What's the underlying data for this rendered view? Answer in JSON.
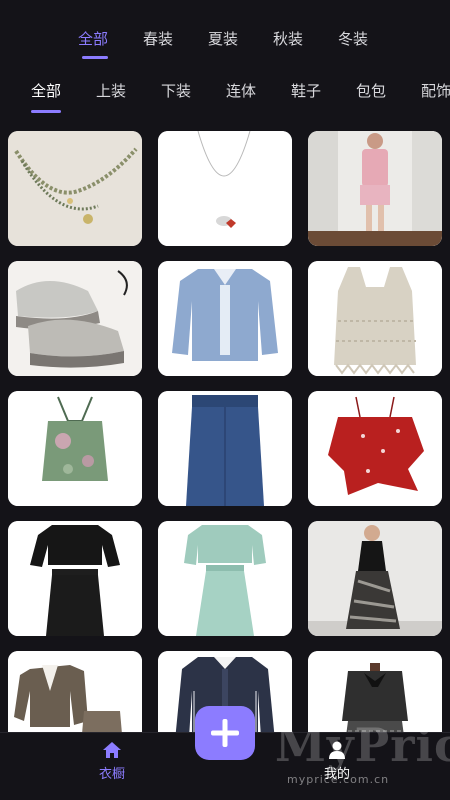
{
  "season_tabs": [
    "全部",
    "春装",
    "夏装",
    "秋装",
    "冬装"
  ],
  "season_active": "全部",
  "category_tabs": [
    "全部",
    "上装",
    "下装",
    "连体",
    "鞋子",
    "包包",
    "配饰"
  ],
  "category_active": "全部",
  "items": [
    {
      "name": "beaded-necklace"
    },
    {
      "name": "pendant-necklace"
    },
    {
      "name": "pink-cardigan-outfit"
    },
    {
      "name": "chunky-sneakers"
    },
    {
      "name": "denim-shirt"
    },
    {
      "name": "crochet-vest"
    },
    {
      "name": "halter-top"
    },
    {
      "name": "denim-midi-skirt"
    },
    {
      "name": "red-floral-camisole"
    },
    {
      "name": "black-knit-set"
    },
    {
      "name": "mint-knit-set"
    },
    {
      "name": "black-dress-outfit"
    },
    {
      "name": "tweed-jacket-set"
    },
    {
      "name": "navy-cardigan"
    },
    {
      "name": "black-bow-outfit"
    }
  ],
  "bottom_nav": {
    "closet_label": "衣橱",
    "mine_label": "我的",
    "closet_icon": "home-icon",
    "mine_icon": "user-icon",
    "add_icon": "plus-icon"
  },
  "watermark": {
    "brand": "MyPrice",
    "url": "myprice.com.cn"
  },
  "colors": {
    "accent": "#8c7cff",
    "background": "#141318"
  }
}
